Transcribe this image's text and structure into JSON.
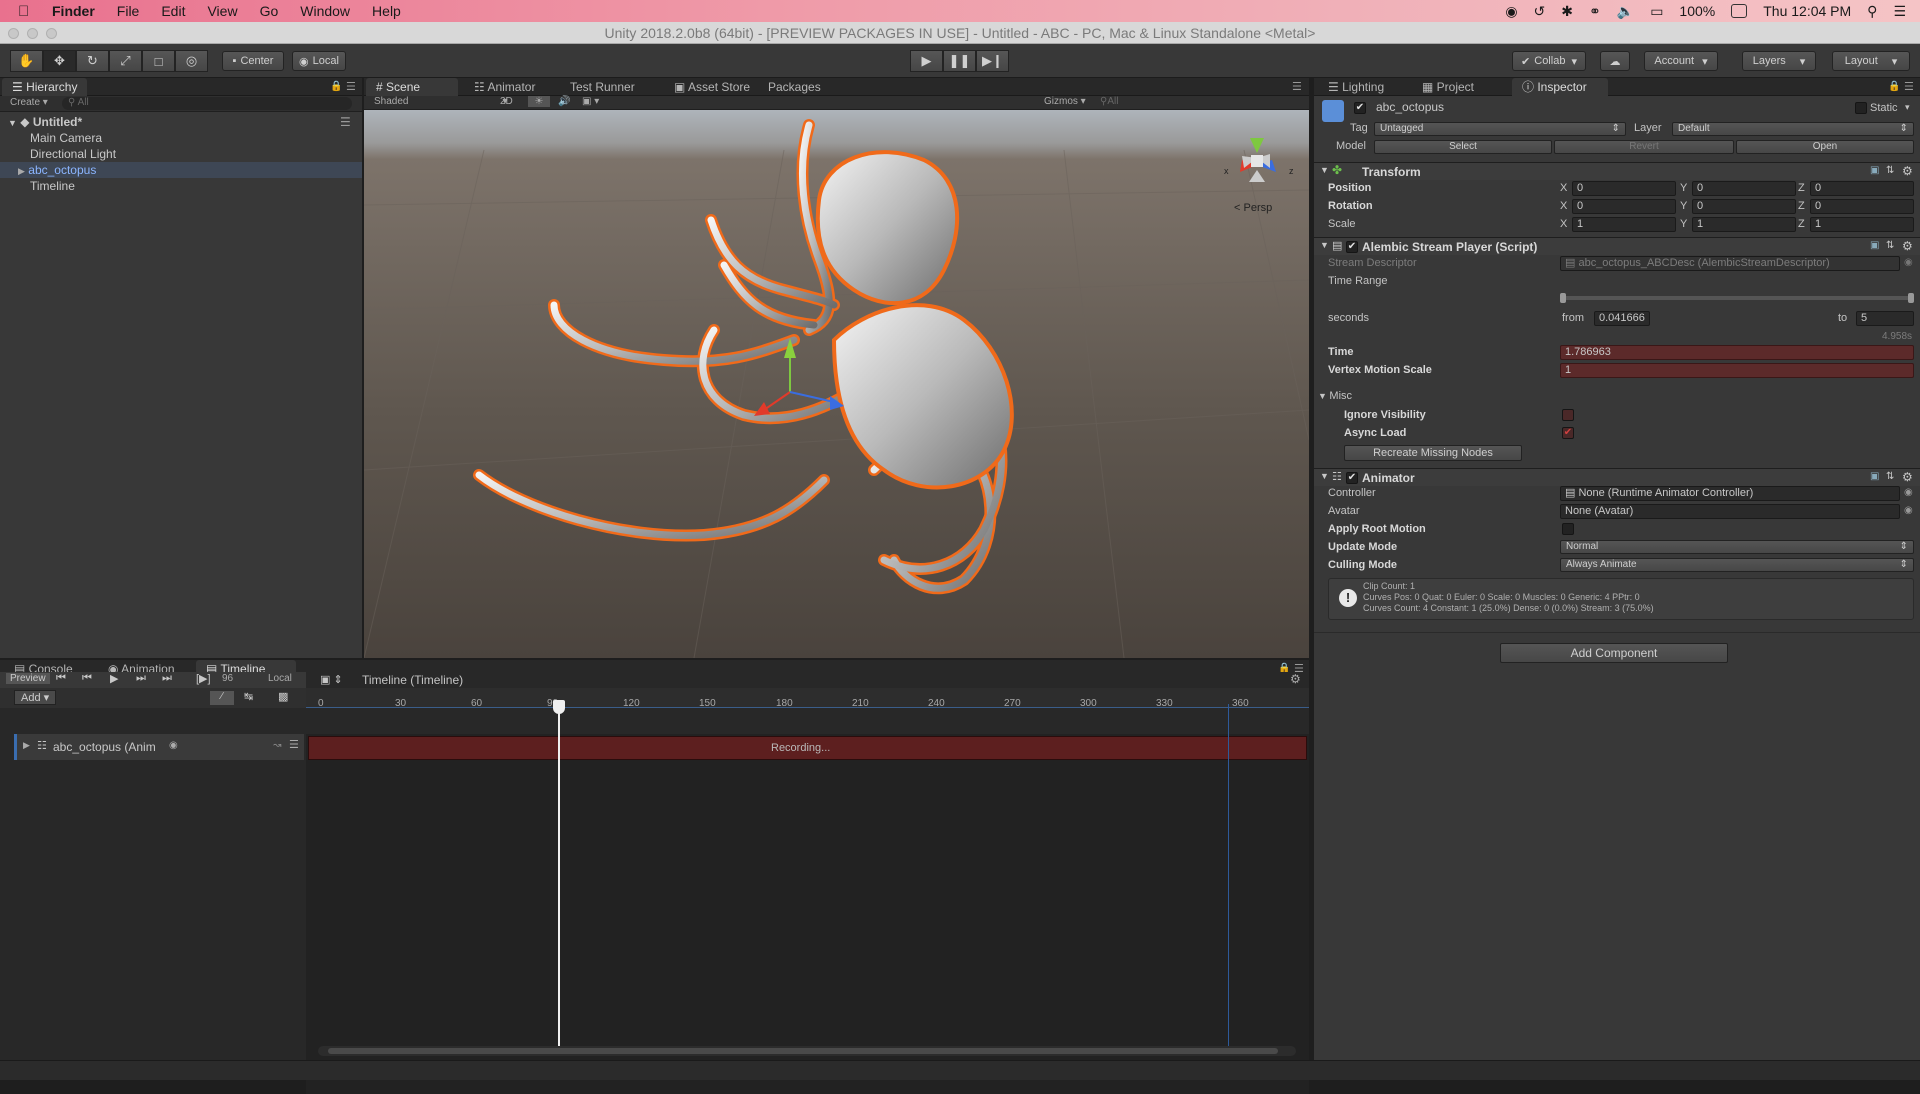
{
  "menubar": {
    "app": "Finder",
    "items": [
      "File",
      "Edit",
      "View",
      "Go",
      "Window",
      "Help"
    ],
    "battery": "100%",
    "clock": "Thu 12:04 PM"
  },
  "window": {
    "title": "Unity 2018.2.0b8 (64bit) - [PREVIEW PACKAGES IN USE] - Untitled - ABC - PC, Mac & Linux Standalone <Metal>"
  },
  "toolbar": {
    "pivot": "Center",
    "space": "Local",
    "collab": "Collab",
    "account": "Account",
    "layers": "Layers",
    "layout": "Layout"
  },
  "hierarchy": {
    "tab": "Hierarchy",
    "create": "Create",
    "search_placeholder": "All",
    "scene": "Untitled*",
    "items": [
      "Main Camera",
      "Directional Light",
      "abc_octopus",
      "Timeline"
    ]
  },
  "scene_tabs": [
    "Scene",
    "Animator",
    "Test Runner",
    "Asset Store",
    "Packages"
  ],
  "scene_bar": {
    "shading": "Shaded",
    "mode_2d": "2D",
    "gizmos": "Gizmos",
    "search_placeholder": "All",
    "persp": "Persp"
  },
  "inspector_tabs": [
    "Lighting",
    "Project",
    "Inspector"
  ],
  "inspector": {
    "object_name": "abc_octopus",
    "static": "Static",
    "tag_label": "Tag",
    "tag": "Untagged",
    "layer_label": "Layer",
    "layer": "Default",
    "model_label": "Model",
    "model_buttons": [
      "Select",
      "Revert",
      "Open"
    ],
    "transform": {
      "title": "Transform",
      "rows": [
        {
          "label": "Position",
          "x": "0",
          "y": "0",
          "z": "0"
        },
        {
          "label": "Rotation",
          "x": "0",
          "y": "0",
          "z": "0"
        },
        {
          "label": "Scale",
          "x": "1",
          "y": "1",
          "z": "1"
        }
      ]
    },
    "alembic": {
      "title": "Alembic Stream Player (Script)",
      "stream_descriptor_label": "Stream Descriptor",
      "stream_descriptor": "abc_octopus_ABCDesc (AlembicStreamDescriptor)",
      "time_range_label": "Time Range",
      "seconds_label": "seconds",
      "from_label": "from",
      "from_value": "0.041666",
      "to_label": "to",
      "to_value": "5",
      "duration": "4.958s",
      "time_label": "Time",
      "time_value": "1.786963",
      "vms_label": "Vertex Motion Scale",
      "vms_value": "1",
      "misc_label": "Misc",
      "ignore_visibility_label": "Ignore Visibility",
      "async_load_label": "Async Load",
      "recreate_button": "Recreate Missing Nodes"
    },
    "animator": {
      "title": "Animator",
      "controller_label": "Controller",
      "controller": "None (Runtime Animator Controller)",
      "avatar_label": "Avatar",
      "avatar": "None (Avatar)",
      "apply_root_motion_label": "Apply Root Motion",
      "update_mode_label": "Update Mode",
      "update_mode": "Normal",
      "culling_mode_label": "Culling Mode",
      "culling_mode": "Always Animate",
      "info_lines": [
        "Clip Count: 1",
        "Curves Pos: 0 Quat: 0 Euler: 0 Scale: 0 Muscles: 0 Generic: 4 PPtr: 0",
        "Curves Count: 4 Constant: 1 (25.0%) Dense: 0 (0.0%) Stream: 3 (75.0%)"
      ]
    },
    "add_component": "Add Component"
  },
  "bottom_tabs": [
    "Console",
    "Animation",
    "Timeline"
  ],
  "timeline": {
    "preview": "Preview",
    "frame": "96",
    "local": "Local",
    "title": "Timeline (Timeline)",
    "add": "Add",
    "track_name": "abc_octopus (Anim",
    "clip_label": "Recording...",
    "ruler": [
      "0",
      "30",
      "60",
      "90",
      "120",
      "150",
      "180",
      "210",
      "240",
      "270",
      "300",
      "330",
      "360"
    ]
  }
}
